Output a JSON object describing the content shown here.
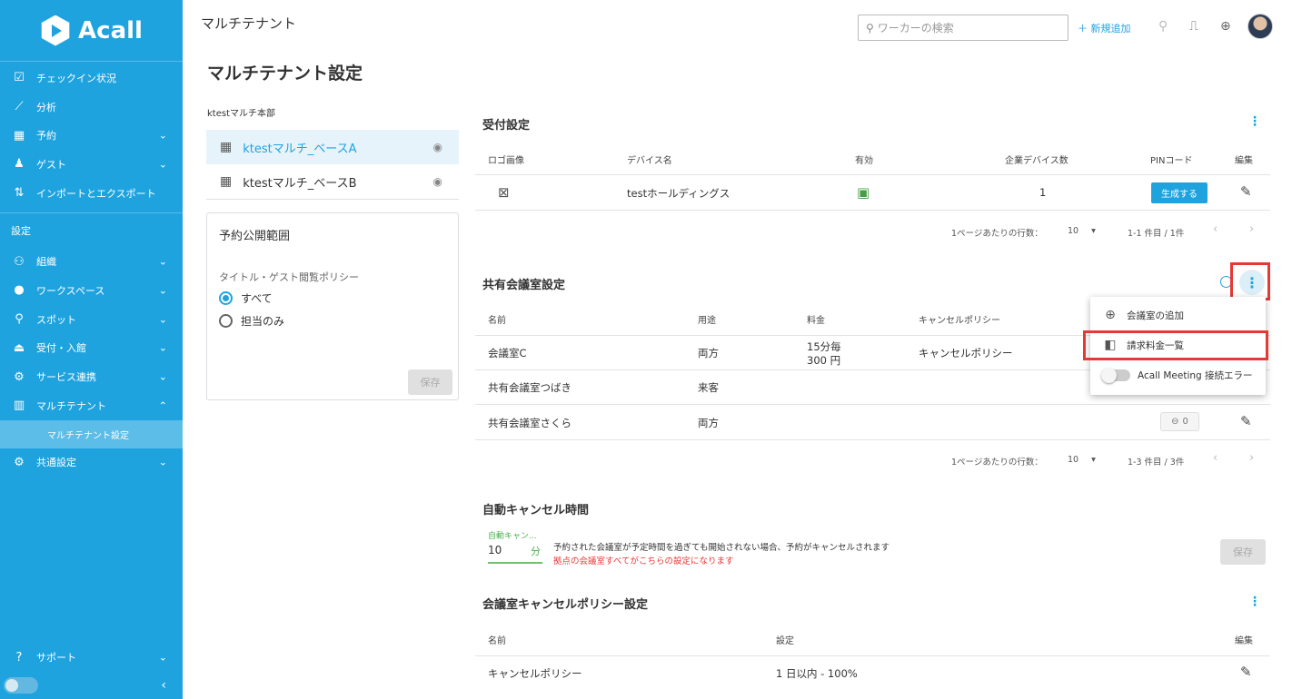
{
  "sidebar": {
    "brand": "Acall",
    "items": [
      {
        "label": "チェックイン状況",
        "icon": "checkbox-icon"
      },
      {
        "label": "分析",
        "icon": "chart-icon"
      },
      {
        "label": "予約",
        "icon": "calendar-icon"
      },
      {
        "label": "ゲスト",
        "icon": "guest-icon"
      },
      {
        "label": "インポートとエクスポート",
        "icon": "import-export-icon"
      }
    ],
    "section_label": "設定",
    "settings_items": [
      {
        "label": "組織",
        "icon": "people-icon"
      },
      {
        "label": "ワークスペース",
        "icon": "location-icon"
      },
      {
        "label": "スポット",
        "icon": "spot-icon"
      },
      {
        "label": "受付・入館",
        "icon": "bell-icon"
      },
      {
        "label": "サービス連携",
        "icon": "link-icon"
      },
      {
        "label": "マルチテナント",
        "icon": "building-icon"
      }
    ],
    "sub_item": "マルチテナント設定",
    "common_settings": "共通設定",
    "support": "サポート"
  },
  "topbar": {
    "title": "マルチテナント",
    "search_placeholder": "ワーカーの検索",
    "add_new": "＋ 新規追加"
  },
  "page_title": "マルチテナント設定",
  "org_name": "ktestマルチ本部",
  "tenants": [
    "ktestマルチ_ベースA",
    "ktestマルチ_ベースB"
  ],
  "publication": {
    "title": "予約公開範囲",
    "policy_label": "タイトル・ゲスト閲覧ポリシー",
    "options": [
      "すべて",
      "担当のみ"
    ],
    "selected": "すべて",
    "save": "保存"
  },
  "reception": {
    "title": "受付設定",
    "headers": [
      "ロゴ画像",
      "デバイス名",
      "有効",
      "企業デバイス数",
      "PINコード",
      "編集"
    ],
    "rows": [
      {
        "device": "testホールディングス",
        "count": "1",
        "pin_button": "生成する"
      }
    ],
    "rows_per_page_label": "1ページあたりの行数：",
    "rows_per_page": "10",
    "range": "1-1 件目 / 1件"
  },
  "shared_rooms": {
    "title": "共有会議室設定",
    "headers": [
      "名前",
      "用途",
      "料金",
      "キャンセルポリシー"
    ],
    "rows": [
      {
        "name": "会議室C",
        "usage": "両方",
        "fee_line1": "15分毎",
        "fee_line2": "300 円",
        "policy": "キャンセルポリシー"
      },
      {
        "name": "共有会議室つばき",
        "usage": "来客",
        "fee_line1": "",
        "fee_line2": "",
        "policy": ""
      },
      {
        "name": "共有会議室さくら",
        "usage": "両方",
        "fee_line1": "",
        "fee_line2": "",
        "policy": "",
        "link_count": "0"
      }
    ],
    "rows_per_page_label": "1ページあたりの行数：",
    "rows_per_page": "10",
    "range": "1-3 件目 / 3件"
  },
  "menu": {
    "items": [
      "会議室の追加",
      "請求料金一覧",
      "Acall Meeting 接続エラー"
    ]
  },
  "auto_cancel": {
    "title": "自動キャンセル時間",
    "field_label": "自動キャン...",
    "value": "10",
    "unit": "分",
    "description": "予約された会議室が予定時間を過ぎても開始されない場合、予約がキャンセルされます",
    "warning": "拠点の会議室すべてがこちらの設定になります",
    "save": "保存"
  },
  "cancel_policy": {
    "title": "会議室キャンセルポリシー設定",
    "headers": [
      "名前",
      "設定",
      "編集"
    ],
    "rows": [
      {
        "name": "キャンセルポリシー",
        "setting": "1 日以内 - 100%"
      }
    ]
  }
}
